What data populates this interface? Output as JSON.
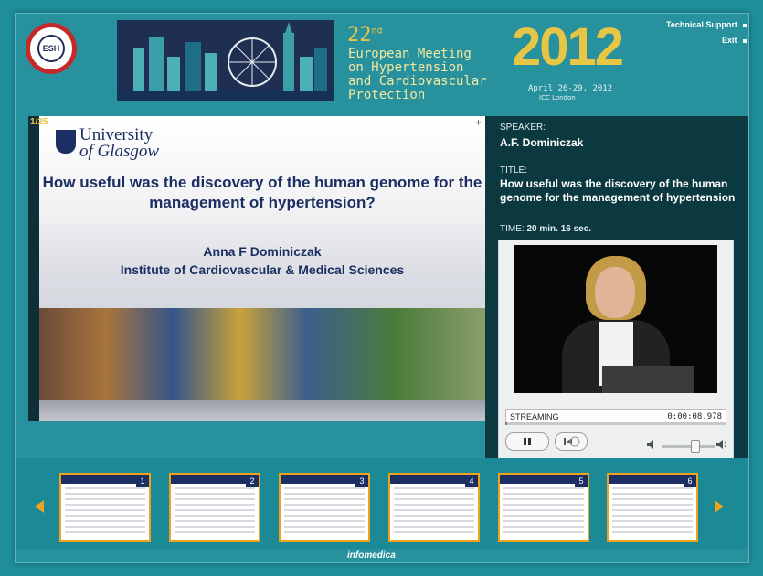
{
  "header": {
    "logo_text": "ESH",
    "meeting_number": "22",
    "meeting_suffix": "nd",
    "meeting_title": "European Meeting\non Hypertension\nand Cardiovascular\nProtection",
    "year": "2012",
    "dates": "April 26-29, 2012",
    "venue": "ICC London",
    "links": {
      "support": "Technical Support",
      "exit": "Exit"
    }
  },
  "slide": {
    "counter": "1/25",
    "university_line1": "University",
    "university_line2": "of Glasgow",
    "title": "How useful was the discovery of the human genome for the management of hypertension?",
    "author": "Anna F Dominiczak",
    "institute": "Institute of Cardiovascular & Medical Sciences",
    "plus": "+"
  },
  "info": {
    "speaker_label": "SPEAKER:",
    "speaker_name": "A.F. Dominiczak",
    "title_label": "TITLE:",
    "title_value": "How useful was the discovery of the human genome for the management of hypertension",
    "time_label": "TIME:",
    "time_value": "20 min. 16 sec."
  },
  "player": {
    "status": "STREAMING",
    "elapsed": "0:00:08.978",
    "progress": 0.01,
    "volume": 0.7
  },
  "thumbnails": [
    "1",
    "2",
    "3",
    "4",
    "5",
    "6"
  ],
  "footer": {
    "brand": "infomedica"
  },
  "colors": {
    "accent": "#f0a21d",
    "background": "#1f8f9c",
    "panel": "#0c3940"
  }
}
